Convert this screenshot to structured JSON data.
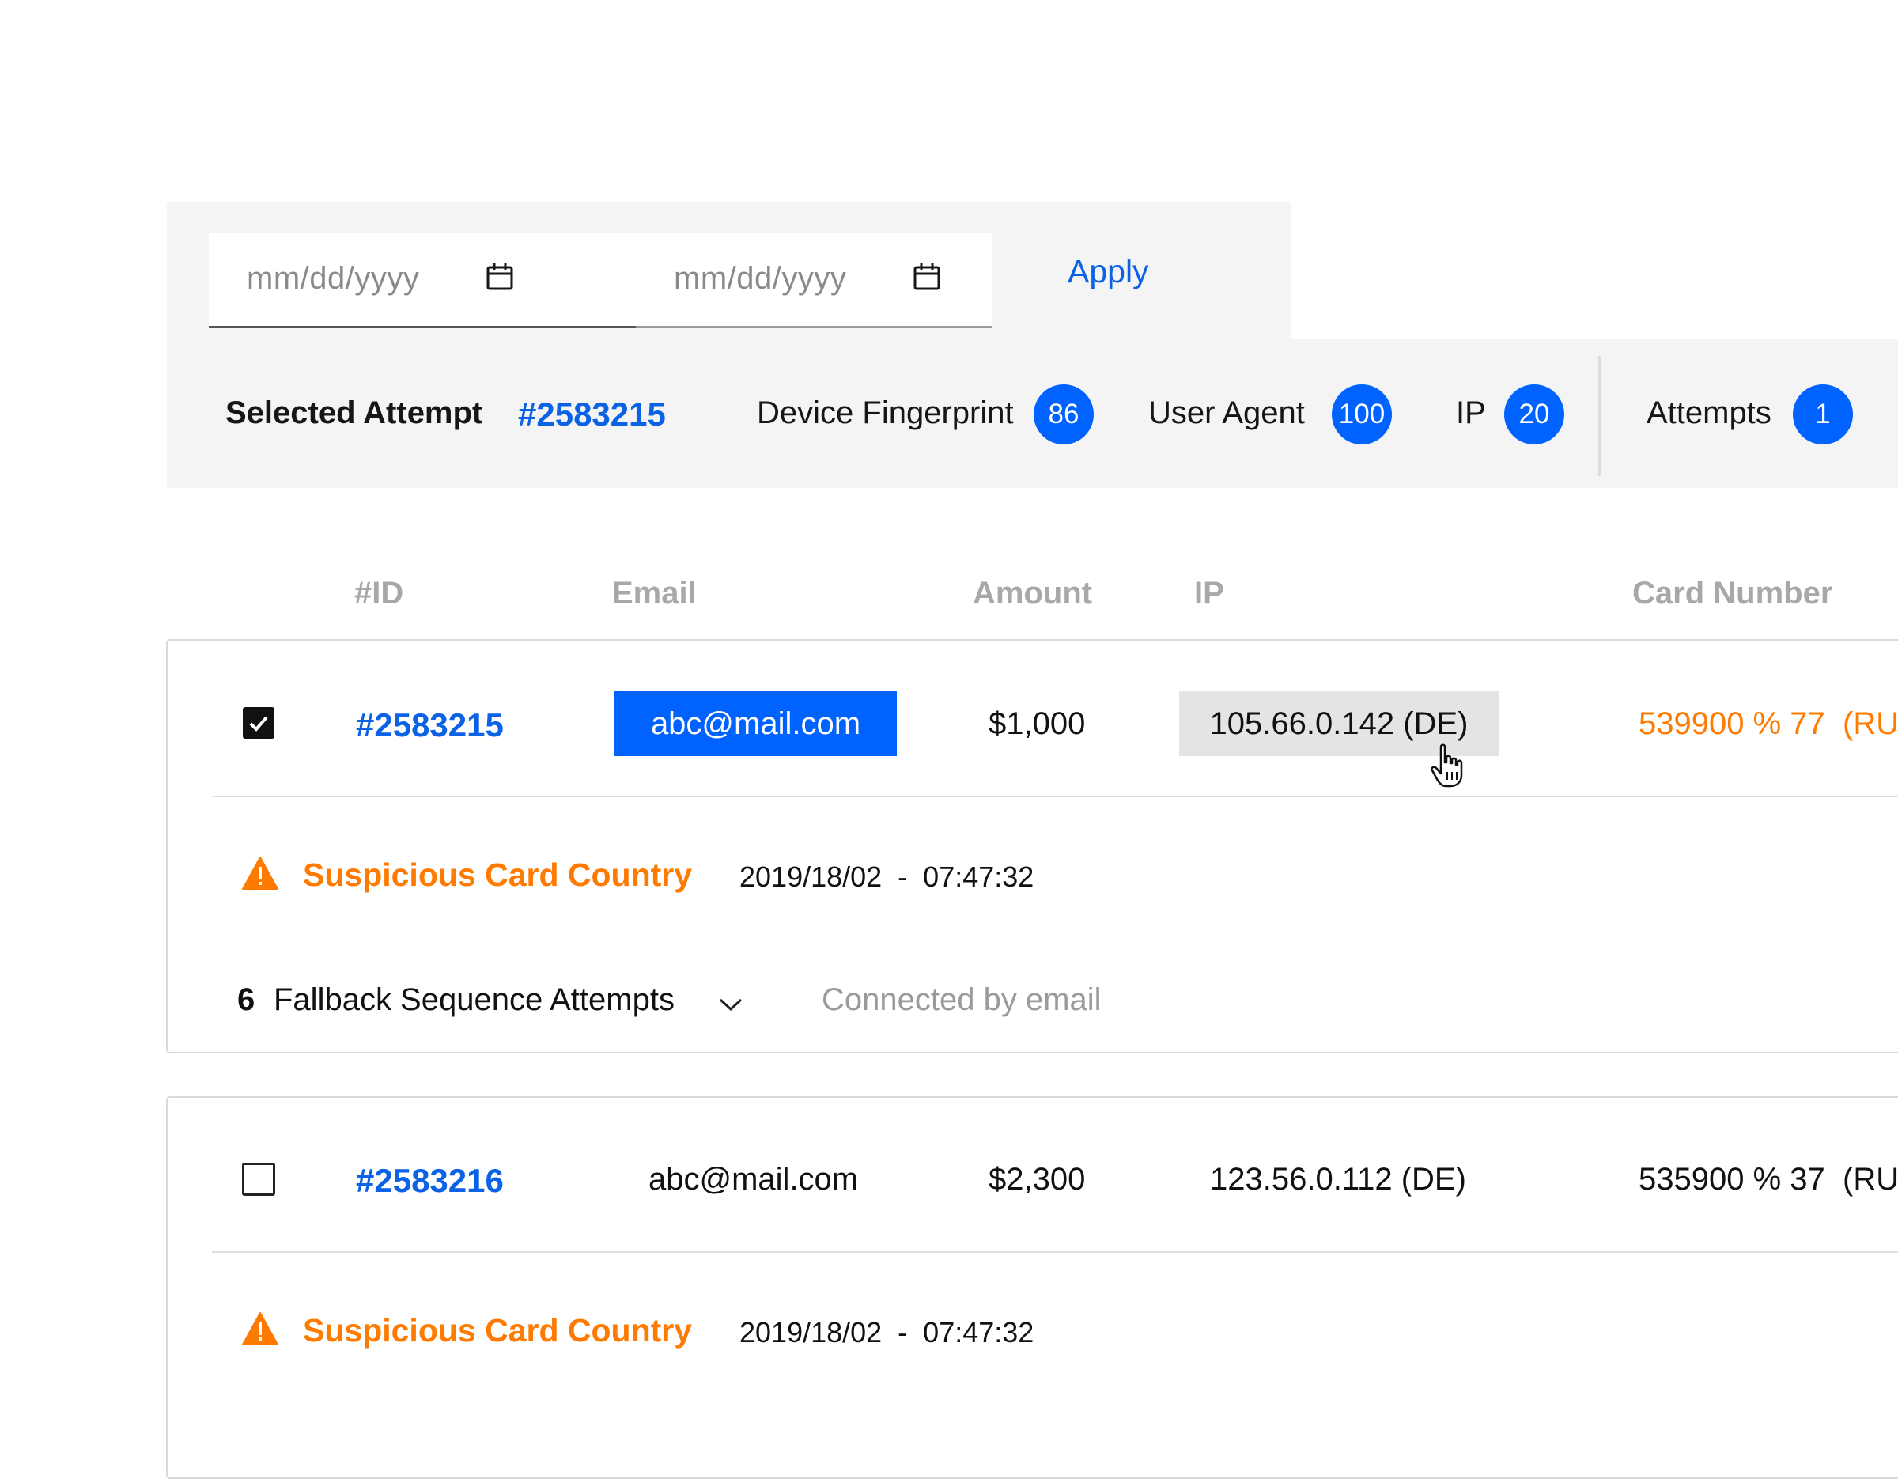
{
  "filter": {
    "start_date_placeholder": "mm/dd/yyyy",
    "end_date_placeholder": "mm/dd/yyyy",
    "apply_label": "Apply",
    "calendar_icon": "calendar-icon"
  },
  "summary": {
    "selected_label": "Selected Attempt",
    "selected_id": "#2583215",
    "metrics": [
      {
        "label": "Device Fingerprint",
        "count": "86"
      },
      {
        "label": "User Agent",
        "count": "100"
      },
      {
        "label": "IP",
        "count": "20"
      },
      {
        "label": "Attempts",
        "count": "1"
      }
    ]
  },
  "table": {
    "headers": [
      "#ID",
      "Email",
      "Amount",
      "IP",
      "Card Number"
    ],
    "rows": [
      {
        "checked": true,
        "id": "#2583215",
        "email": "abc@mail.com",
        "amount": "$1,000",
        "ip": "105.66.0.142 (DE)",
        "card_number": "539900 % 77",
        "card_country": "(RU",
        "alert": "Suspicious Card Country",
        "timestamp": "2019/18/02  -  07:47:32",
        "fallback_count": "6",
        "fallback_label": "Fallback Sequence Attempts",
        "connected_label": "Connected by email"
      },
      {
        "checked": false,
        "id": "#2583216",
        "email": "abc@mail.com",
        "amount": "$2,300",
        "ip": "123.56.0.112 (DE)",
        "card_number": "535900 % 37",
        "card_country": "(RU",
        "alert": "Suspicious Card Country",
        "timestamp": "2019/18/02  -  07:47:32"
      }
    ]
  },
  "colors": {
    "accent_blue": "#0062ff",
    "link_blue": "#0b62e4",
    "warning_orange": "#ff7a00",
    "panel_bg": "#f4f4f4"
  }
}
